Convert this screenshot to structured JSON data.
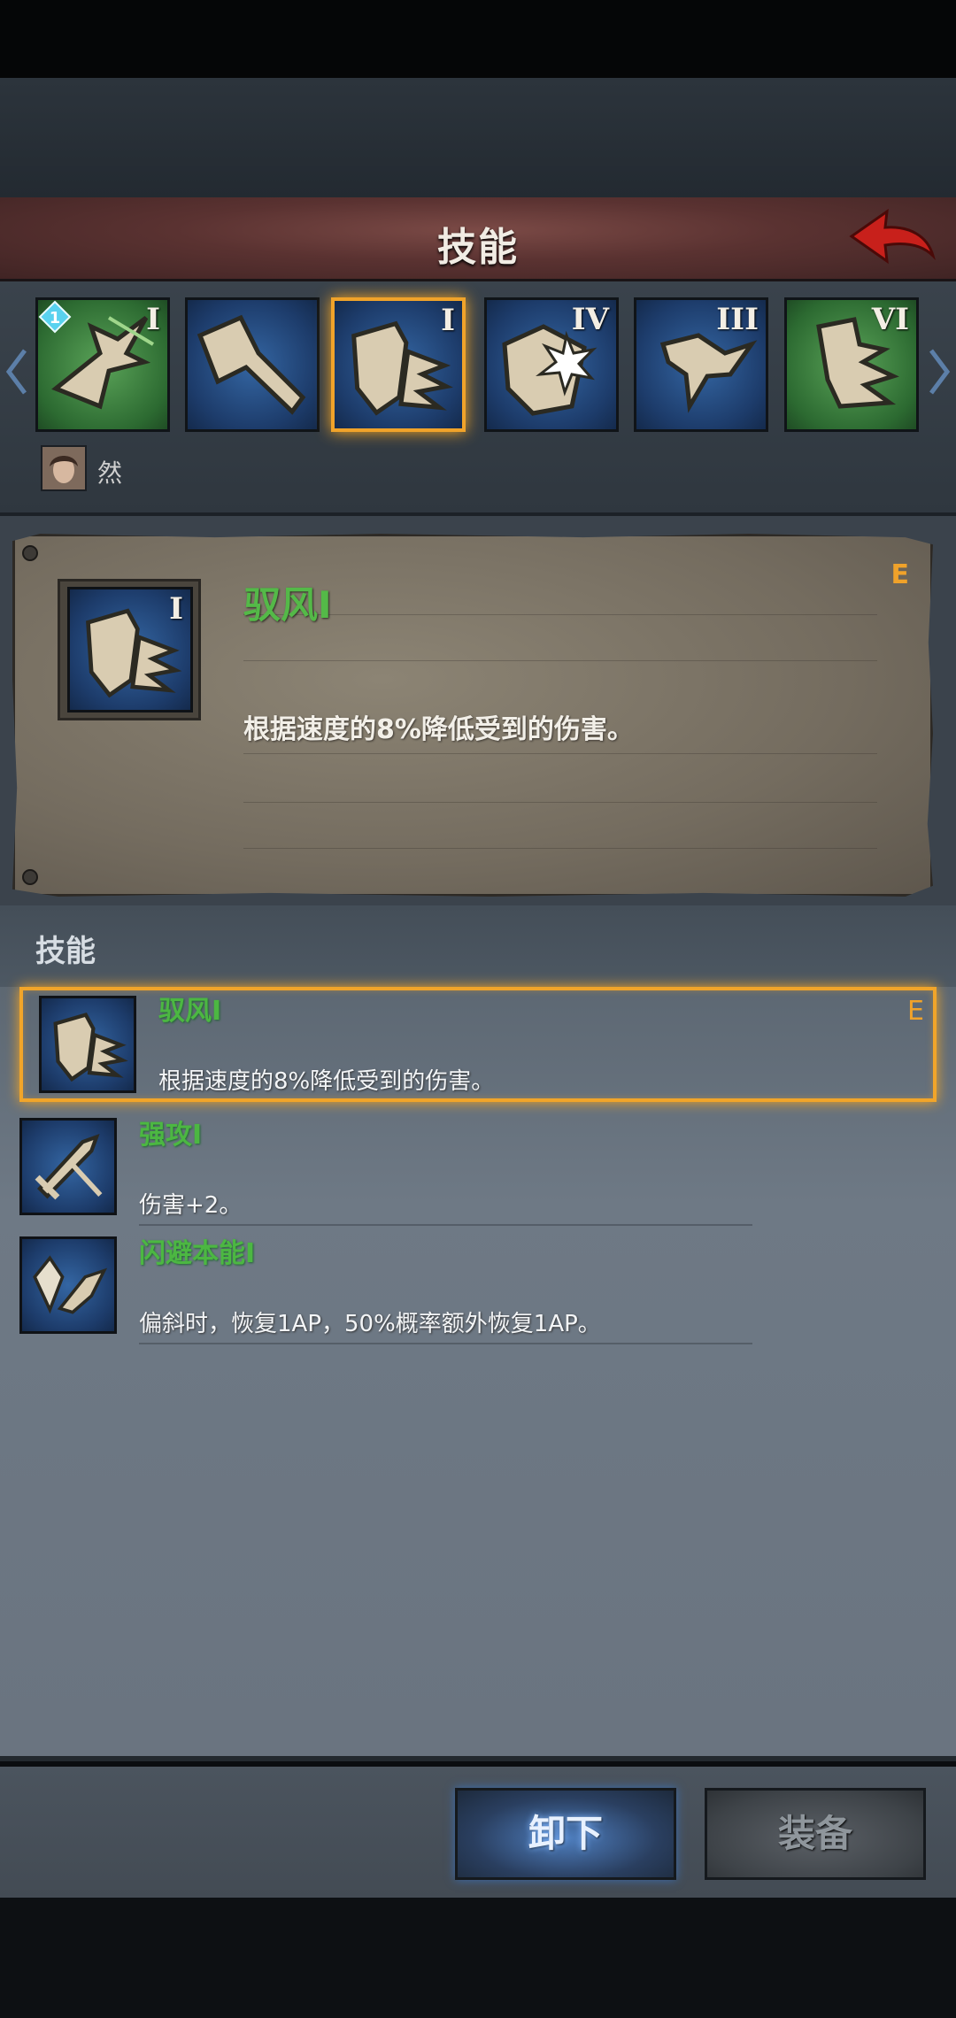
{
  "header": {
    "title": "技能"
  },
  "skill_bar": {
    "slots": [
      {
        "roman": "I",
        "color": "green",
        "badge": "1",
        "icon": "charging-horse-icon"
      },
      {
        "roman": "",
        "color": "blue",
        "icon": "sword-strike-icon"
      },
      {
        "roman": "I",
        "color": "blue",
        "selected": true,
        "icon": "shield-wind-icon"
      },
      {
        "roman": "IV",
        "color": "blue",
        "icon": "shield-burst-icon"
      },
      {
        "roman": "III",
        "color": "blue",
        "icon": "swift-horse-icon"
      },
      {
        "roman": "VI",
        "color": "green",
        "icon": "fist-wind-icon"
      }
    ]
  },
  "character": {
    "name": "然"
  },
  "detail": {
    "roman": "I",
    "name": "驭风I",
    "grade": "E",
    "description": "根据速度的8%降低受到的伤害。"
  },
  "skills_section": {
    "title": "技能",
    "items": [
      {
        "name": "驭风I",
        "description": "根据速度的8%降低受到的伤害。",
        "grade": "E",
        "selected": true,
        "icon": "shield-wind-icon"
      },
      {
        "name": "强攻I",
        "description": "伤害+2。",
        "grade": "",
        "icon": "sword-icon"
      },
      {
        "name": "闪避本能I",
        "description": "偏斜时，恢复1AP，50%概率额外恢复1AP。",
        "grade": "",
        "icon": "crystal-horse-icon"
      }
    ]
  },
  "actions": {
    "unequip": "卸下",
    "equip": "装备"
  },
  "colors": {
    "accent": "#f0a22a",
    "skill_name": "#54b948",
    "header": "#5a3231"
  }
}
